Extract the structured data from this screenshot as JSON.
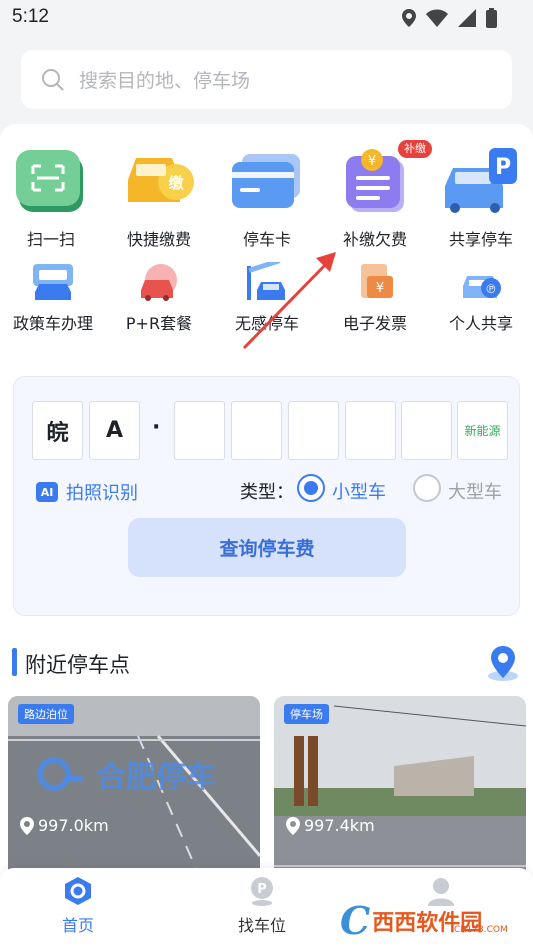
{
  "status": {
    "time": "5:12"
  },
  "search": {
    "placeholder": "搜索目的地、停车场"
  },
  "services_top": [
    {
      "label": "扫一扫",
      "icon": "scan-icon"
    },
    {
      "label": "快捷缴费",
      "icon": "quick-pay-icon"
    },
    {
      "label": "停车卡",
      "icon": "parking-card-icon"
    },
    {
      "label": "补缴欠费",
      "icon": "arrears-icon",
      "badge": "补缴"
    },
    {
      "label": "共享停车",
      "icon": "shared-parking-icon"
    }
  ],
  "services_bottom": [
    {
      "label": "政策车办理",
      "icon": "policy-car-icon"
    },
    {
      "label": "P+R套餐",
      "icon": "pr-package-icon"
    },
    {
      "label": "无感停车",
      "icon": "contactless-parking-icon"
    },
    {
      "label": "电子发票",
      "icon": "e-invoice-icon"
    },
    {
      "label": "个人共享",
      "icon": "personal-share-icon"
    }
  ],
  "plate": {
    "cells": [
      "皖",
      "A",
      "",
      "",
      "",
      "",
      "",
      "新能源"
    ],
    "separator": "·",
    "ai_badge": "AI",
    "photo_label": "拍照识别",
    "type_label": "类型：",
    "small_car": "小型车",
    "large_car": "大型车",
    "selected": "小型车",
    "query_button": "查询停车费"
  },
  "nearby": {
    "title": "附近停车点",
    "cards": [
      {
        "tag": "路边泊位",
        "distance": "997.0km",
        "watermark": "合肥停车"
      },
      {
        "tag": "停车场",
        "distance": "997.4km"
      }
    ]
  },
  "tabbar": [
    {
      "label": "首页",
      "active": true
    },
    {
      "label": "找车位",
      "active": false
    }
  ],
  "watermark": {
    "logo_text": "西西软件园",
    "domain": "CR173.COM"
  },
  "colors": {
    "accent": "#3b7bf0",
    "badge": "#e8413c",
    "new_energy": "#2fae5b"
  }
}
